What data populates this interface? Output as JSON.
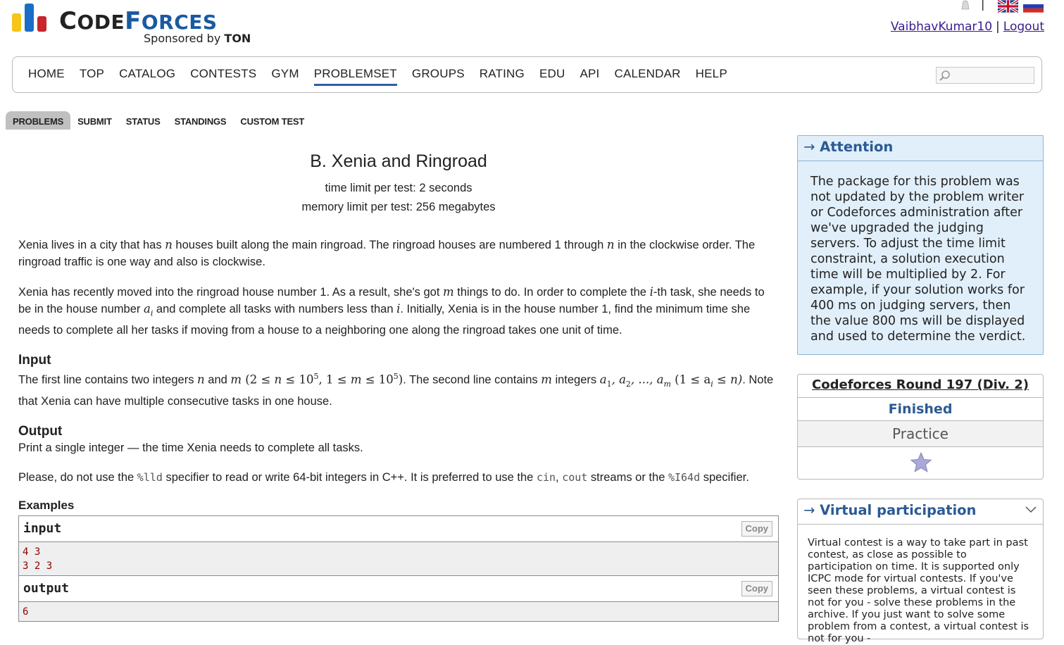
{
  "header": {
    "logo_text_1": "C",
    "logo_text_2": "ODE",
    "logo_text_3": "F",
    "logo_text_4": "ORCES",
    "sponsor_prefix": "Sponsored by",
    "sponsor_name": "TON",
    "username": "VaibhavKumar10",
    "separator": "|",
    "logout": "Logout",
    "lang_separator": "|"
  },
  "nav": {
    "items": [
      "HOME",
      "TOP",
      "CATALOG",
      "CONTESTS",
      "GYM",
      "PROBLEMSET",
      "GROUPS",
      "RATING",
      "EDU",
      "API",
      "CALENDAR",
      "HELP"
    ],
    "active": "PROBLEMSET",
    "search_placeholder": ""
  },
  "second_menu": {
    "items": [
      "PROBLEMS",
      "SUBMIT",
      "STATUS",
      "STANDINGS",
      "CUSTOM TEST"
    ],
    "active": "PROBLEMS"
  },
  "problem": {
    "title": "B. Xenia and Ringroad",
    "time_limit": "time limit per test: 2 seconds",
    "memory_limit": "memory limit per test: 256 megabytes",
    "p1_a": "Xenia lives in a city that has ",
    "p1_n": "n",
    "p1_b": " houses built along the main ringroad. The ringroad houses are numbered 1 through ",
    "p1_n2": "n",
    "p1_c": " in the clockwise order. The ringroad traffic is one way and also is clockwise.",
    "p2_a": "Xenia has recently moved into the ringroad house number 1. As a result, she's got ",
    "p2_m": "m",
    "p2_b": " things to do. In order to complete the ",
    "p2_i": "i",
    "p2_c": "-th task, she needs to be in the house number ",
    "p2_ai": "a",
    "p2_ai_sub": "i",
    "p2_d": " and complete all tasks with numbers less than ",
    "p2_i2": "i",
    "p2_e": ". Initially, Xenia is in the house number 1, find the minimum time she needs to complete all her tasks if moving from a house to a neighboring one along the ringroad takes one unit of time.",
    "input_title": "Input",
    "in_a": "The first line contains two integers ",
    "in_n": "n",
    "in_and": " and ",
    "in_m": "m",
    "in_constraint1": " (2 ≤ ",
    "in_constraint1_n": "n",
    "in_constraint1_b": " ≤ 10",
    "in_sup5": "5",
    "in_comma": ", 1 ≤ ",
    "in_constraint2_m": "m",
    "in_constraint2_b": " ≤ 10",
    "in_sup5b": "5",
    "in_close": ")",
    "in_b": ". The second line contains ",
    "in_m2": "m",
    "in_c": " integers ",
    "in_seq": "a",
    "in_sub1": "1",
    "in_seq_b": ", a",
    "in_sub2": "2",
    "in_seq_c": ", ..., a",
    "in_subm": "m",
    "in_constraint3": " (1 ≤ a",
    "in_subi": "i",
    "in_constraint3_b": " ≤ n)",
    "in_d": ". Note that Xenia can have multiple consecutive tasks in one house.",
    "output_title": "Output",
    "out_text": "Print a single integer — the time Xenia needs to complete all tasks.",
    "note_a": "Please, do not use the ",
    "note_lld": "%lld",
    "note_b": " specifier to read or write 64-bit integers in C++. It is preferred to use the ",
    "note_cin": "cin",
    "note_comma": ", ",
    "note_cout": "cout",
    "note_c": " streams or the ",
    "note_i64d": "%I64d",
    "note_d": " specifier.",
    "examples_title": "Examples",
    "input_label": "input",
    "output_label": "output",
    "copy_label": "Copy",
    "sample_input_line1": "4 3",
    "sample_input_line2": "3 2 3",
    "sample_output_line1": "6"
  },
  "sidebar": {
    "attention_arrow": "→",
    "attention_title": "Attention",
    "attention_text": "The package for this problem was not updated by the problem writer or Codeforces administration after we've upgraded the judging servers. To adjust the time limit constraint, a solution execution time will be multiplied by 2. For example, if your solution works for 400 ms on judging servers, then the value 800 ms will be displayed and used to determine the verdict.",
    "contest_name": "Codeforces Round 197 (Div. 2)",
    "contest_status": "Finished",
    "practice_label": "Practice",
    "virtual_arrow": "→",
    "virtual_title": "Virtual participation",
    "virtual_text": "Virtual contest is a way to take part in past contest, as close as possible to participation on time. It is supported only ICPC mode for virtual contests. If you've seen these problems, a virtual contest is not for you - solve these problems in the archive. If you just want to solve some problem from a contest, a virtual contest is not for you -"
  },
  "colors": {
    "logo_yellow": "#f5c518",
    "logo_blue": "#1a6ec8",
    "logo_red": "#c8252c",
    "accent_blue": "#2b5a94",
    "attention_bg": "#e1effa",
    "sample_text": "#8b0000"
  },
  "icons": [
    "bell-icon",
    "uk-flag-icon",
    "ru-flag-icon",
    "search-icon",
    "star-icon",
    "chevron-down-icon"
  ]
}
